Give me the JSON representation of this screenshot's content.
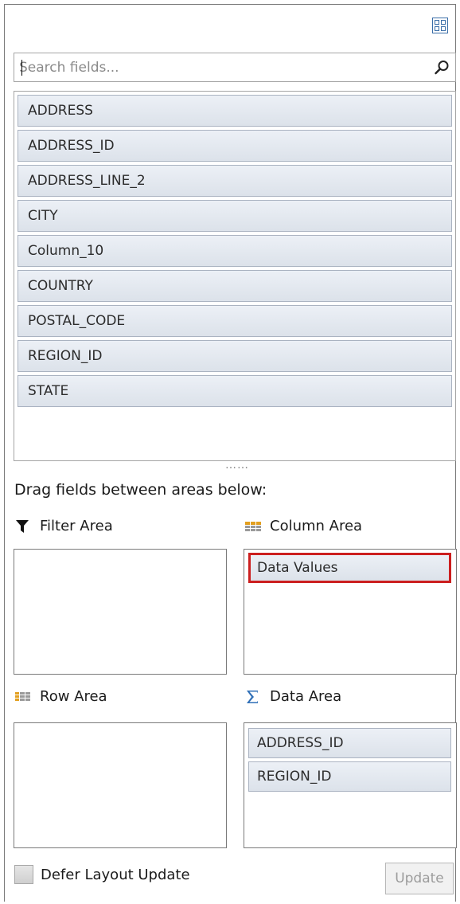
{
  "search": {
    "placeholder": "Search fields..."
  },
  "fields": [
    "ADDRESS",
    "ADDRESS_ID",
    "ADDRESS_LINE_2",
    "CITY",
    "Column_10",
    "COUNTRY",
    "POSTAL_CODE",
    "REGION_ID",
    "STATE"
  ],
  "splitter_glyph": "……",
  "hint": "Drag fields between areas below:",
  "areas": {
    "filter": {
      "label": "Filter Area",
      "icon": "filter-icon",
      "items": []
    },
    "column": {
      "label": "Column Area",
      "icon": "column-area-icon",
      "items": [
        "Data Values"
      ],
      "selected": "Data Values",
      "selected_color": "#cc1f1f"
    },
    "row": {
      "label": "Row Area",
      "icon": "row-area-icon",
      "items": []
    },
    "data": {
      "label": "Data Area",
      "icon": "sigma-icon",
      "items": [
        "ADDRESS_ID",
        "REGION_ID"
      ]
    }
  },
  "defer": {
    "label": "Defer Layout Update",
    "checked": false
  },
  "update_button": {
    "label": "Update",
    "enabled": false
  }
}
